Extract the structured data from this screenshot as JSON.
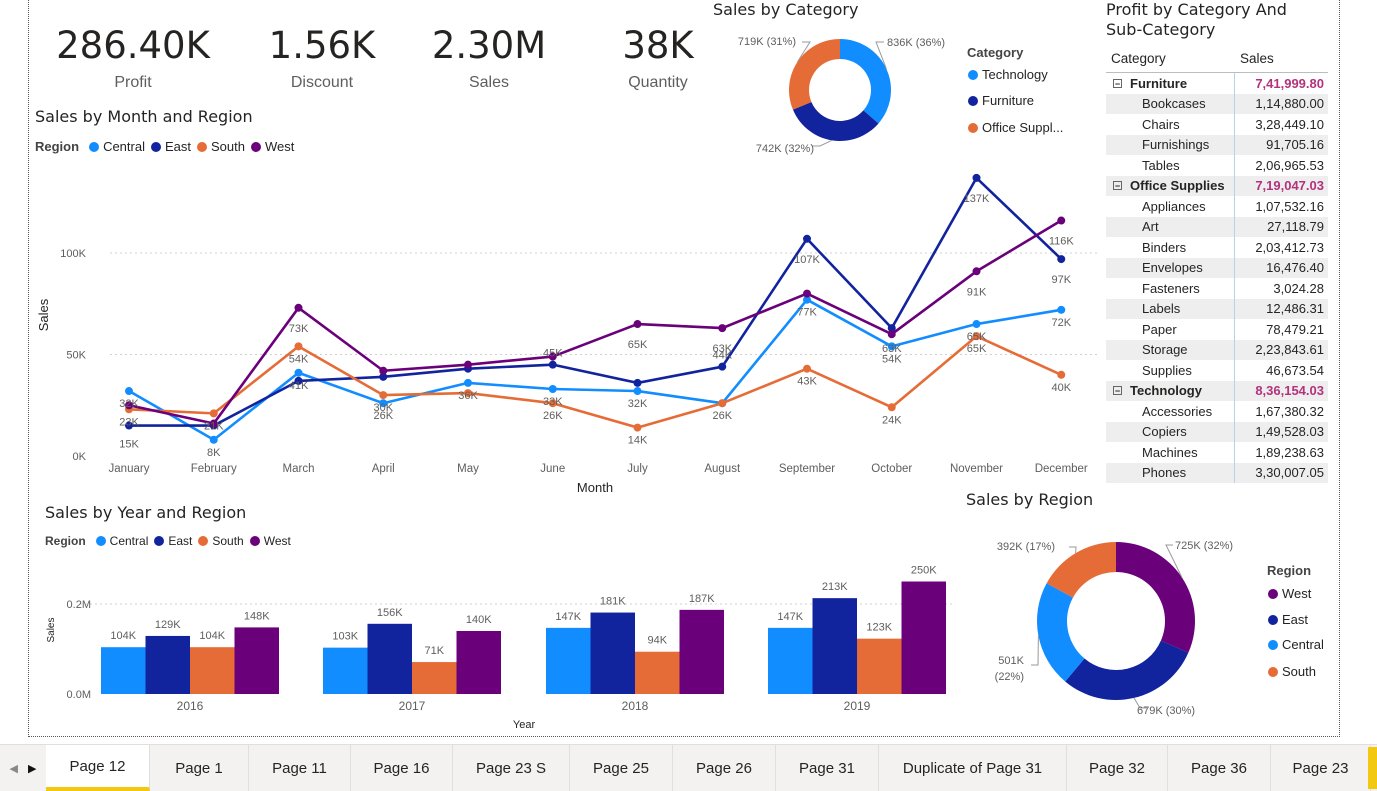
{
  "kpis": [
    {
      "value": "286.40K",
      "label": "Profit"
    },
    {
      "value": "1.56K",
      "label": "Discount"
    },
    {
      "value": "2.30M",
      "label": "Sales"
    },
    {
      "value": "38K",
      "label": "Quantity"
    }
  ],
  "colors": {
    "Central": "#118dff",
    "East": "#12239e",
    "South": "#e66c37",
    "West": "#6b007b",
    "Technology": "#118dff",
    "Furniture": "#12239e",
    "OfficeSupplies": "#e66c37"
  },
  "sales_by_category": {
    "title": "Sales by Category",
    "legend_title": "Category",
    "legend": [
      "Technology",
      "Furniture",
      "Office Suppl..."
    ]
  },
  "line_chart": {
    "title": "Sales by Month and Region",
    "legend_title": "Region",
    "legend": [
      "Central",
      "East",
      "South",
      "West"
    ]
  },
  "bar_chart": {
    "title": "Sales by Year and Region",
    "legend_title": "Region",
    "legend": [
      "Central",
      "East",
      "South",
      "West"
    ]
  },
  "region_donut": {
    "title": "Sales by Region",
    "legend_title": "Region",
    "legend": [
      "West",
      "East",
      "Central",
      "South"
    ]
  },
  "matrix": {
    "title": "Profit by Category And Sub-Category",
    "col_category": "Category",
    "col_sales": "Sales",
    "rows": [
      {
        "type": "cat",
        "name": "Furniture",
        "value": "7,41,999.80"
      },
      {
        "type": "sub",
        "name": "Bookcases",
        "value": "1,14,880.00"
      },
      {
        "type": "sub",
        "name": "Chairs",
        "value": "3,28,449.10"
      },
      {
        "type": "sub",
        "name": "Furnishings",
        "value": "91,705.16"
      },
      {
        "type": "sub",
        "name": "Tables",
        "value": "2,06,965.53"
      },
      {
        "type": "cat",
        "name": "Office Supplies",
        "value": "7,19,047.03"
      },
      {
        "type": "sub",
        "name": "Appliances",
        "value": "1,07,532.16"
      },
      {
        "type": "sub",
        "name": "Art",
        "value": "27,118.79"
      },
      {
        "type": "sub",
        "name": "Binders",
        "value": "2,03,412.73"
      },
      {
        "type": "sub",
        "name": "Envelopes",
        "value": "16,476.40"
      },
      {
        "type": "sub",
        "name": "Fasteners",
        "value": "3,024.28"
      },
      {
        "type": "sub",
        "name": "Labels",
        "value": "12,486.31"
      },
      {
        "type": "sub",
        "name": "Paper",
        "value": "78,479.21"
      },
      {
        "type": "sub",
        "name": "Storage",
        "value": "2,23,843.61"
      },
      {
        "type": "sub",
        "name": "Supplies",
        "value": "46,673.54"
      },
      {
        "type": "cat",
        "name": "Technology",
        "value": "8,36,154.03"
      },
      {
        "type": "sub",
        "name": "Accessories",
        "value": "1,67,380.32"
      },
      {
        "type": "sub",
        "name": "Copiers",
        "value": "1,49,528.03"
      },
      {
        "type": "sub",
        "name": "Machines",
        "value": "1,89,238.63"
      },
      {
        "type": "sub",
        "name": "Phones",
        "value": "3,30,007.05"
      }
    ]
  },
  "tabs": [
    "Page 12",
    "Page 1",
    "Page 11",
    "Page 16",
    "Page 23 S",
    "Page 25",
    "Page 26",
    "Page 31",
    "Duplicate of Page 31",
    "Page 32",
    "Page 36",
    "Page 23"
  ],
  "active_tab": "Page 12",
  "chart_data": [
    {
      "type": "pie",
      "title": "Sales by Category",
      "categories": [
        "Technology",
        "Furniture",
        "Office Supplies"
      ],
      "values": [
        836,
        742,
        719
      ],
      "labels": [
        "836K (36%)",
        "742K (32%)",
        "719K (31%)"
      ]
    },
    {
      "type": "line",
      "title": "Sales by Month and Region",
      "xlabel": "Month",
      "ylabel": "Sales",
      "categories": [
        "January",
        "February",
        "March",
        "April",
        "May",
        "June",
        "July",
        "August",
        "September",
        "October",
        "November",
        "December"
      ],
      "yticks": [
        "0K",
        "50K",
        "100K"
      ],
      "ylim": [
        0,
        140
      ],
      "series": [
        {
          "name": "Central",
          "values": [
            32,
            8,
            41,
            26,
            36,
            33,
            32,
            26,
            77,
            54,
            65,
            72
          ],
          "labels": [
            "32K",
            "8K",
            "41K",
            "26K",
            "36K",
            "33K",
            "32K",
            "26K",
            "77K",
            "54K",
            "65K",
            "72K"
          ]
        },
        {
          "name": "East",
          "values": [
            15,
            15,
            37,
            39,
            43,
            45,
            36,
            44,
            107,
            63,
            137,
            97
          ],
          "labels": [
            "15K",
            "",
            "",
            "",
            "",
            "45K",
            "",
            "44K",
            "107K",
            "63K",
            "137K",
            "97K"
          ]
        },
        {
          "name": "South",
          "values": [
            23,
            21,
            54,
            30,
            31,
            26,
            14,
            26,
            43,
            24,
            59,
            40
          ],
          "labels": [
            "23K",
            "21K",
            "54K",
            "30K",
            "",
            "26K",
            "14K",
            "",
            "43K",
            "24K",
            "65K",
            "40K"
          ]
        },
        {
          "name": "West",
          "values": [
            25,
            16,
            73,
            42,
            45,
            49,
            65,
            63,
            80,
            60,
            91,
            116
          ],
          "labels": [
            "",
            "",
            "73K",
            "",
            "",
            "",
            "65K",
            "63K",
            "",
            "",
            "91K",
            "116K"
          ]
        }
      ]
    },
    {
      "type": "bar",
      "title": "Sales by Year and Region",
      "xlabel": "Year",
      "ylabel": "Sales",
      "categories": [
        "2016",
        "2017",
        "2018",
        "2019"
      ],
      "yticks": [
        "0.0M",
        "0.2M"
      ],
      "ylim": [
        0,
        0.27
      ],
      "series": [
        {
          "name": "Central",
          "values": [
            104,
            103,
            147,
            147
          ],
          "labels": [
            "104K",
            "103K",
            "147K",
            "147K"
          ]
        },
        {
          "name": "East",
          "values": [
            129,
            156,
            181,
            213
          ],
          "labels": [
            "129K",
            "156K",
            "181K",
            "213K"
          ]
        },
        {
          "name": "South",
          "values": [
            104,
            71,
            94,
            123
          ],
          "labels": [
            "104K",
            "71K",
            "94K",
            "123K"
          ]
        },
        {
          "name": "West",
          "values": [
            148,
            140,
            187,
            250
          ],
          "labels": [
            "148K",
            "140K",
            "187K",
            "250K"
          ]
        }
      ]
    },
    {
      "type": "pie",
      "title": "Sales by Region",
      "categories": [
        "West",
        "East",
        "Central",
        "South"
      ],
      "values": [
        725,
        679,
        501,
        392
      ],
      "labels": [
        "725K (32%)",
        "679K (30%)",
        "501K (22%)",
        "392K (17%)"
      ]
    }
  ]
}
